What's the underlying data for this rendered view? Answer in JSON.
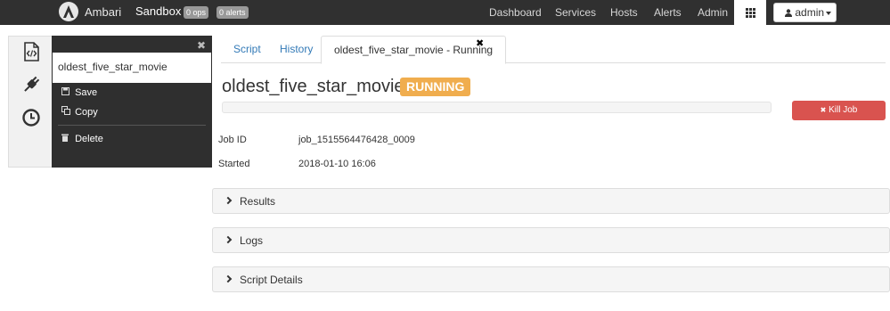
{
  "navbar": {
    "brand": "Ambari",
    "cluster": "Sandbox",
    "ops_badge": "0 ops",
    "alerts_badge": "0 alerts",
    "links": [
      "Dashboard",
      "Services",
      "Hosts",
      "Alerts",
      "Admin"
    ],
    "user_menu": "admin"
  },
  "sidebar_icons": [
    "script-icon",
    "plug-icon",
    "clock-icon"
  ],
  "script_panel": {
    "title": "oldest_five_star_movie",
    "close": "✖",
    "items": [
      {
        "label": "Save",
        "icon": "save-icon"
      },
      {
        "label": "Copy",
        "icon": "copy-icon"
      },
      {
        "label": "Delete",
        "icon": "trash-icon"
      }
    ]
  },
  "tabs": [
    {
      "label": "Script",
      "active": false
    },
    {
      "label": "History",
      "active": false
    },
    {
      "label": "oldest_five_star_movie - Running",
      "active": true
    }
  ],
  "tab_close": "✖",
  "job": {
    "title": "oldest_five_star_movie -",
    "status": "RUNNING",
    "status_color": "#f0ad4e",
    "progress_percent": 0,
    "kill_label": "Kill Job",
    "kill_color": "#d9534f",
    "fields": [
      {
        "label": "Job ID",
        "value": "job_1515564476428_0009"
      },
      {
        "label": "Started",
        "value": "2018-01-10 16:06"
      }
    ]
  },
  "sections": [
    "Results",
    "Logs",
    "Script Details"
  ]
}
